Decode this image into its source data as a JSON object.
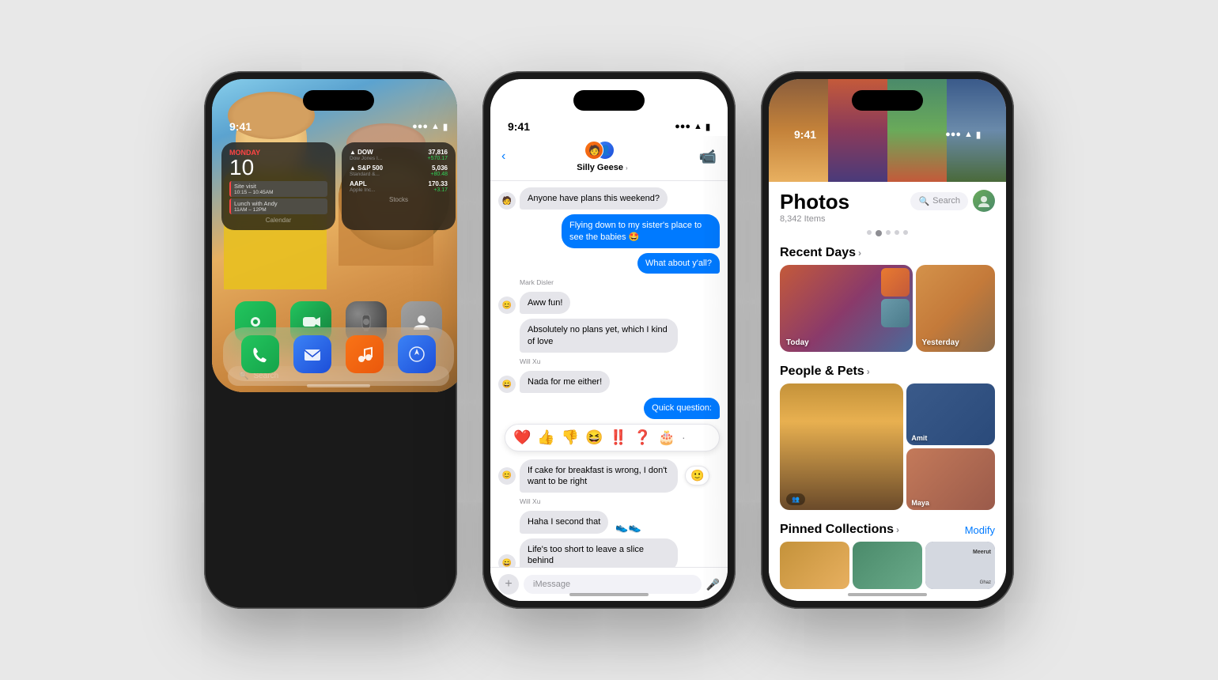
{
  "background": "#e8e8e8",
  "phone1": {
    "status": {
      "time": "9:41",
      "signal": "▌▌▌",
      "wifi": "WiFi",
      "battery": "Battery"
    },
    "widget_calendar": {
      "label": "Calendar",
      "day_name": "MONDAY",
      "day_number": "10",
      "event1": "Site visit",
      "event1_time": "10:15 – 10:45AM",
      "event2": "Lunch with Andy",
      "event2_time": "11AM – 12PM"
    },
    "widget_stocks": {
      "label": "Stocks",
      "items": [
        {
          "ticker": "▲ DOW",
          "name": "Dow Jones I...",
          "price": "37,816",
          "change": "+570.17"
        },
        {
          "ticker": "▲ S&P 500",
          "name": "Standard &...",
          "price": "5,036",
          "change": "+80.48"
        },
        {
          "ticker": "AAPL",
          "name": "Apple Inc...",
          "price": "170.33",
          "change": "+3.17"
        }
      ]
    },
    "apps_row1": [
      {
        "name": "Find My",
        "icon": "📍"
      },
      {
        "name": "FaceTime",
        "icon": "📹"
      },
      {
        "name": "Watch",
        "icon": "⌚"
      },
      {
        "name": "Contacts",
        "icon": "👤"
      }
    ],
    "search_placeholder": "Search",
    "dock_apps": [
      {
        "name": "Phone",
        "icon": "📞"
      },
      {
        "name": "Mail",
        "icon": "✉️"
      },
      {
        "name": "Music",
        "icon": "🎵"
      },
      {
        "name": "Safari",
        "icon": "🧭"
      }
    ]
  },
  "phone2": {
    "status": {
      "time": "9:41"
    },
    "header": {
      "group_name": "Silly Geese",
      "chevron": "›",
      "back_label": "‹"
    },
    "messages": [
      {
        "type": "received",
        "text": "Anyone have plans this weekend?",
        "sender": null,
        "avatar": "😊"
      },
      {
        "type": "sent",
        "text": "Flying down to my sister's place to see the babies 🤩",
        "sender": null
      },
      {
        "type": "sent",
        "text": "What about y'all?",
        "sender": null
      },
      {
        "type": "sender_label",
        "text": "Mark Disler"
      },
      {
        "type": "received",
        "text": "Aww fun!",
        "sender": "mark",
        "avatar": "🙂"
      },
      {
        "type": "received",
        "text": "Absolutely no plans yet, which I kind of love",
        "sender": "mark",
        "avatar": null
      },
      {
        "type": "sender_label",
        "text": "Will Xu"
      },
      {
        "type": "received",
        "text": "Nada for me either!",
        "sender": "will",
        "avatar": "😄"
      },
      {
        "type": "sent",
        "text": "Quick question:",
        "sender": null
      },
      {
        "type": "received",
        "text": "If cake for breakfast is wrong, I don't want to be right",
        "sender": "mark",
        "avatar": "🙂"
      },
      {
        "type": "sender_label",
        "text": "Will Xu"
      },
      {
        "type": "received",
        "text": "Haha I second that",
        "sender": "will",
        "avatar": null,
        "reaction": "👟👟"
      },
      {
        "type": "received",
        "text": "Life's too short to leave a slice behind",
        "sender": "will",
        "avatar": "😄"
      }
    ],
    "tapbacks": [
      "❤️",
      "👍",
      "👎",
      "😆",
      "‼️",
      "❓",
      "🎂",
      "·"
    ],
    "compose_placeholder": "iMessage"
  },
  "phone3": {
    "status": {
      "time": "9:41"
    },
    "title": "Photos",
    "count": "8,342 Items",
    "search_label": "Search",
    "sections": {
      "recent_days": "Recent Days",
      "recent_days_chevron": "›",
      "today_label": "Today",
      "yesterday_label": "Yesterday",
      "people_pets": "People & Pets",
      "people_pets_chevron": "›",
      "person1": "Amit",
      "person2": "Maya",
      "pinned": "Pinned Collections",
      "pinned_chevron": "›",
      "modify_label": "Modify"
    }
  }
}
